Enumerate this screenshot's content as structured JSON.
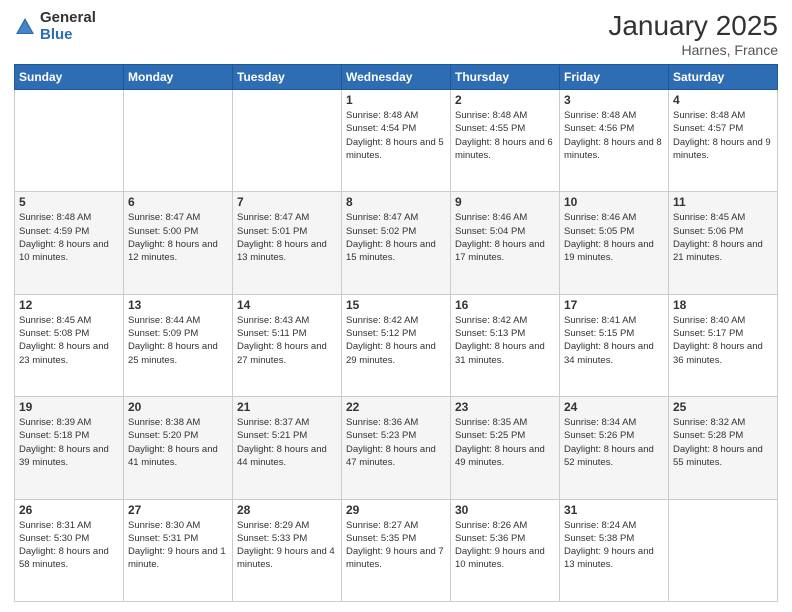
{
  "logo": {
    "general": "General",
    "blue": "Blue"
  },
  "header": {
    "month": "January 2025",
    "location": "Harnes, France"
  },
  "days_of_week": [
    "Sunday",
    "Monday",
    "Tuesday",
    "Wednesday",
    "Thursday",
    "Friday",
    "Saturday"
  ],
  "weeks": [
    [
      {
        "day": "",
        "info": ""
      },
      {
        "day": "",
        "info": ""
      },
      {
        "day": "",
        "info": ""
      },
      {
        "day": "1",
        "info": "Sunrise: 8:48 AM\nSunset: 4:54 PM\nDaylight: 8 hours\nand 5 minutes."
      },
      {
        "day": "2",
        "info": "Sunrise: 8:48 AM\nSunset: 4:55 PM\nDaylight: 8 hours\nand 6 minutes."
      },
      {
        "day": "3",
        "info": "Sunrise: 8:48 AM\nSunset: 4:56 PM\nDaylight: 8 hours\nand 8 minutes."
      },
      {
        "day": "4",
        "info": "Sunrise: 8:48 AM\nSunset: 4:57 PM\nDaylight: 8 hours\nand 9 minutes."
      }
    ],
    [
      {
        "day": "5",
        "info": "Sunrise: 8:48 AM\nSunset: 4:59 PM\nDaylight: 8 hours\nand 10 minutes."
      },
      {
        "day": "6",
        "info": "Sunrise: 8:47 AM\nSunset: 5:00 PM\nDaylight: 8 hours\nand 12 minutes."
      },
      {
        "day": "7",
        "info": "Sunrise: 8:47 AM\nSunset: 5:01 PM\nDaylight: 8 hours\nand 13 minutes."
      },
      {
        "day": "8",
        "info": "Sunrise: 8:47 AM\nSunset: 5:02 PM\nDaylight: 8 hours\nand 15 minutes."
      },
      {
        "day": "9",
        "info": "Sunrise: 8:46 AM\nSunset: 5:04 PM\nDaylight: 8 hours\nand 17 minutes."
      },
      {
        "day": "10",
        "info": "Sunrise: 8:46 AM\nSunset: 5:05 PM\nDaylight: 8 hours\nand 19 minutes."
      },
      {
        "day": "11",
        "info": "Sunrise: 8:45 AM\nSunset: 5:06 PM\nDaylight: 8 hours\nand 21 minutes."
      }
    ],
    [
      {
        "day": "12",
        "info": "Sunrise: 8:45 AM\nSunset: 5:08 PM\nDaylight: 8 hours\nand 23 minutes."
      },
      {
        "day": "13",
        "info": "Sunrise: 8:44 AM\nSunset: 5:09 PM\nDaylight: 8 hours\nand 25 minutes."
      },
      {
        "day": "14",
        "info": "Sunrise: 8:43 AM\nSunset: 5:11 PM\nDaylight: 8 hours\nand 27 minutes."
      },
      {
        "day": "15",
        "info": "Sunrise: 8:42 AM\nSunset: 5:12 PM\nDaylight: 8 hours\nand 29 minutes."
      },
      {
        "day": "16",
        "info": "Sunrise: 8:42 AM\nSunset: 5:13 PM\nDaylight: 8 hours\nand 31 minutes."
      },
      {
        "day": "17",
        "info": "Sunrise: 8:41 AM\nSunset: 5:15 PM\nDaylight: 8 hours\nand 34 minutes."
      },
      {
        "day": "18",
        "info": "Sunrise: 8:40 AM\nSunset: 5:17 PM\nDaylight: 8 hours\nand 36 minutes."
      }
    ],
    [
      {
        "day": "19",
        "info": "Sunrise: 8:39 AM\nSunset: 5:18 PM\nDaylight: 8 hours\nand 39 minutes."
      },
      {
        "day": "20",
        "info": "Sunrise: 8:38 AM\nSunset: 5:20 PM\nDaylight: 8 hours\nand 41 minutes."
      },
      {
        "day": "21",
        "info": "Sunrise: 8:37 AM\nSunset: 5:21 PM\nDaylight: 8 hours\nand 44 minutes."
      },
      {
        "day": "22",
        "info": "Sunrise: 8:36 AM\nSunset: 5:23 PM\nDaylight: 8 hours\nand 47 minutes."
      },
      {
        "day": "23",
        "info": "Sunrise: 8:35 AM\nSunset: 5:25 PM\nDaylight: 8 hours\nand 49 minutes."
      },
      {
        "day": "24",
        "info": "Sunrise: 8:34 AM\nSunset: 5:26 PM\nDaylight: 8 hours\nand 52 minutes."
      },
      {
        "day": "25",
        "info": "Sunrise: 8:32 AM\nSunset: 5:28 PM\nDaylight: 8 hours\nand 55 minutes."
      }
    ],
    [
      {
        "day": "26",
        "info": "Sunrise: 8:31 AM\nSunset: 5:30 PM\nDaylight: 8 hours\nand 58 minutes."
      },
      {
        "day": "27",
        "info": "Sunrise: 8:30 AM\nSunset: 5:31 PM\nDaylight: 9 hours\nand 1 minute."
      },
      {
        "day": "28",
        "info": "Sunrise: 8:29 AM\nSunset: 5:33 PM\nDaylight: 9 hours\nand 4 minutes."
      },
      {
        "day": "29",
        "info": "Sunrise: 8:27 AM\nSunset: 5:35 PM\nDaylight: 9 hours\nand 7 minutes."
      },
      {
        "day": "30",
        "info": "Sunrise: 8:26 AM\nSunset: 5:36 PM\nDaylight: 9 hours\nand 10 minutes."
      },
      {
        "day": "31",
        "info": "Sunrise: 8:24 AM\nSunset: 5:38 PM\nDaylight: 9 hours\nand 13 minutes."
      },
      {
        "day": "",
        "info": ""
      }
    ]
  ]
}
